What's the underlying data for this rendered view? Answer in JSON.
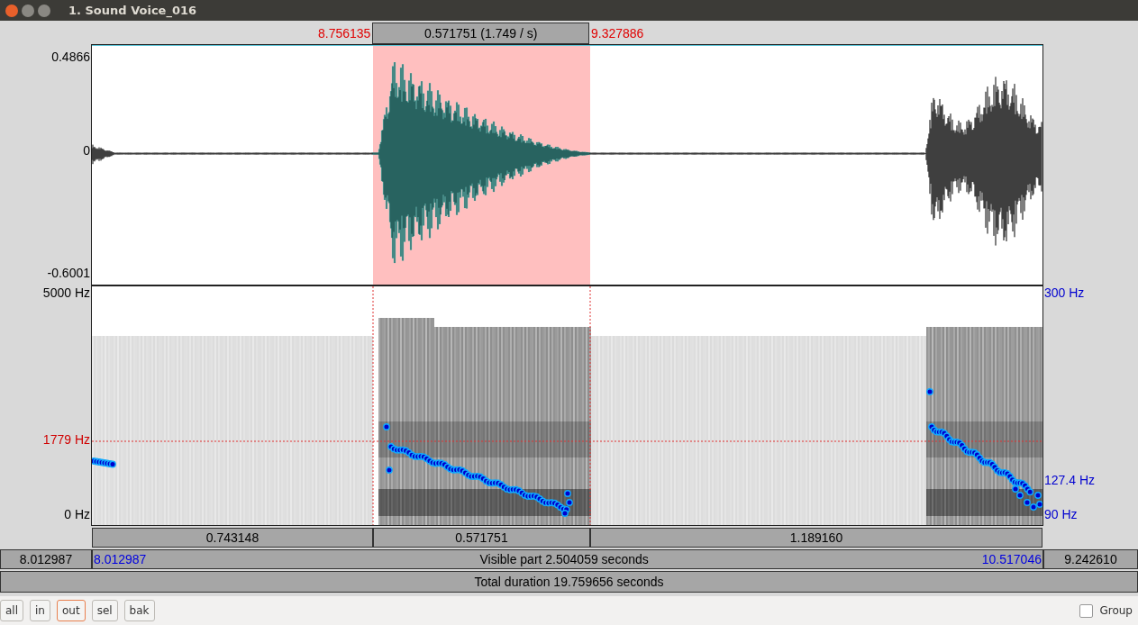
{
  "window": {
    "title": "1. Sound Voice_016"
  },
  "selection": {
    "start": "8.756135",
    "duration": "0.571751 (1.749 / s)",
    "end": "9.327886"
  },
  "waveform": {
    "y_max": "0.4866",
    "y_zero": "0",
    "y_min": "-0.6001"
  },
  "spectrogram": {
    "f_max": "5000 Hz",
    "cursor_freq": "1779 Hz",
    "f_min": "0 Hz"
  },
  "pitch": {
    "max": "300 Hz",
    "cursor": "127.4 Hz",
    "min": "90 Hz"
  },
  "segments": [
    "0.743148",
    "0.571751",
    "1.189160"
  ],
  "visible": {
    "left_outside": "8.012987",
    "start": "8.012987",
    "label": "Visible part 2.504059 seconds",
    "end": "10.517046",
    "right_outside": "9.242610"
  },
  "total": "Total duration 19.759656 seconds",
  "buttons": [
    {
      "label": "all",
      "selected": false
    },
    {
      "label": "in",
      "selected": false
    },
    {
      "label": "out",
      "selected": true
    },
    {
      "label": "sel",
      "selected": false
    },
    {
      "label": "bak",
      "selected": false
    }
  ],
  "group": {
    "label": "Group",
    "checked": false
  }
}
